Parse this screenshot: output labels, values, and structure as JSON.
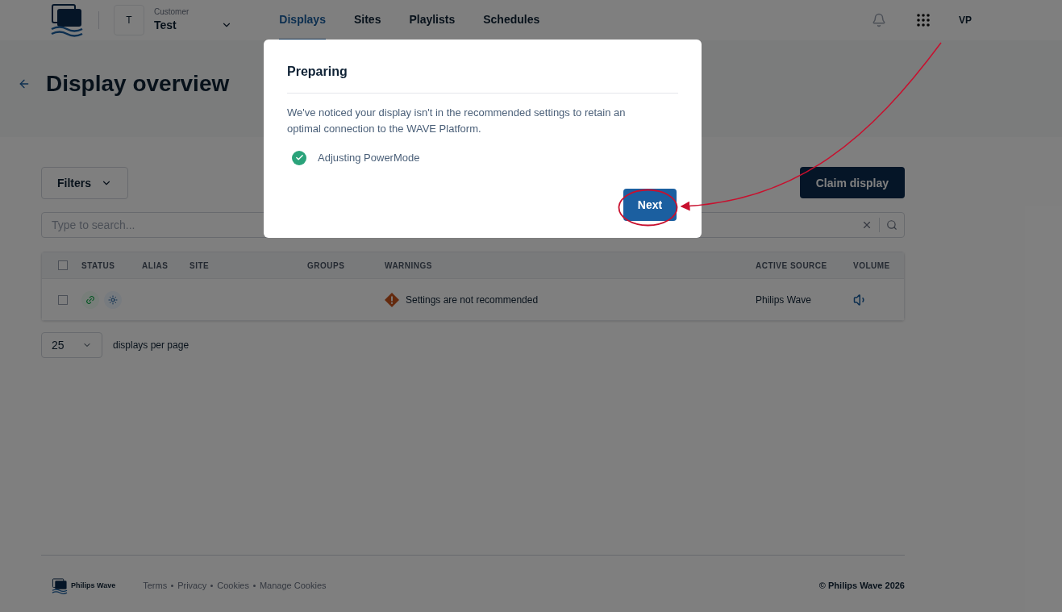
{
  "header": {
    "customer_label": "Customer",
    "customer_initial": "T",
    "customer_name": "Test",
    "nav": [
      {
        "label": "Displays",
        "selected": true
      },
      {
        "label": "Sites",
        "selected": false
      },
      {
        "label": "Playlists",
        "selected": false
      },
      {
        "label": "Schedules",
        "selected": false
      }
    ],
    "user_initials": "VP"
  },
  "page": {
    "title": "Display overview"
  },
  "toolbar": {
    "filters": "Filters",
    "claim": "Claim display",
    "search_placeholder": "Type to search..."
  },
  "table": {
    "select_all": false,
    "columns": [
      "STATUS",
      "ALIAS",
      "SITE",
      "GROUPS",
      "WARNINGS",
      "ACTIVE SOURCE",
      "VOLUME"
    ],
    "rows": [
      {
        "checked": false,
        "warning": "Settings are not recommended",
        "active_source": "Philips Wave"
      }
    ]
  },
  "pagination": {
    "page_size": "25",
    "label": "displays per page"
  },
  "footer": {
    "brand": "Philips Wave",
    "links": [
      "Terms",
      "Privacy",
      "Cookies",
      "Manage Cookies"
    ],
    "copyright": "© Philips Wave 2026"
  },
  "dialog": {
    "title": "Preparing",
    "message": "We've noticed your display isn't in the recommended settings to retain an optimal connection to the WAVE Platform.",
    "steps": [
      {
        "label": "Adjusting PowerMode",
        "done": true
      }
    ],
    "button": "Next"
  }
}
